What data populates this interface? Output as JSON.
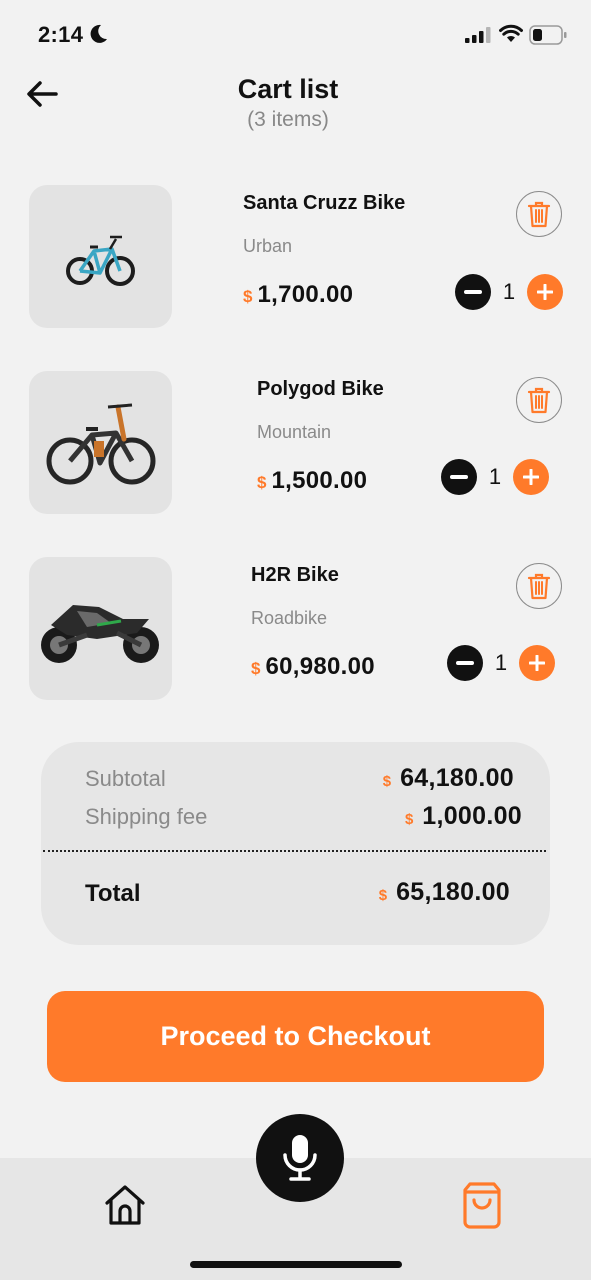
{
  "status_bar": {
    "time": "2:14",
    "icons": [
      "moon-icon",
      "signal-icon",
      "wifi-icon",
      "battery-icon"
    ]
  },
  "header": {
    "back_icon": "arrow-left-icon",
    "title": "Cart list",
    "subtitle": "(3 items)"
  },
  "items": [
    {
      "name": "Santa Cruzz Bike",
      "category": "Urban",
      "currency": "$",
      "price": "1,700.00",
      "quantity": "1",
      "image": "mountain-bike-teal-icon"
    },
    {
      "name": "Polygod Bike",
      "category": "Mountain",
      "currency": "$",
      "price": "1,500.00",
      "quantity": "1",
      "image": "downhill-bike-orange-icon"
    },
    {
      "name": "H2R Bike",
      "category": "Roadbike",
      "currency": "$",
      "price": "60,980.00",
      "quantity": "1",
      "image": "sport-motorcycle-icon"
    }
  ],
  "summary": {
    "subtotal_label": "Subtotal",
    "subtotal_currency": "$",
    "subtotal_value": "64,180.00",
    "shipping_label": "Shipping fee",
    "shipping_currency": "$",
    "shipping_value": "1,000.00",
    "total_label": "Total",
    "total_currency": "$",
    "total_value": "65,180.00"
  },
  "checkout": {
    "label": "Proceed to Checkout"
  },
  "nav": {
    "items": [
      "home-icon",
      "microphone-icon",
      "shopping-bag-icon"
    ]
  },
  "colors": {
    "accent": "#ff7a2a",
    "background": "#f2f2f2",
    "card": "#e6e6e6",
    "text": "#111111",
    "muted": "#8a8a8a"
  }
}
